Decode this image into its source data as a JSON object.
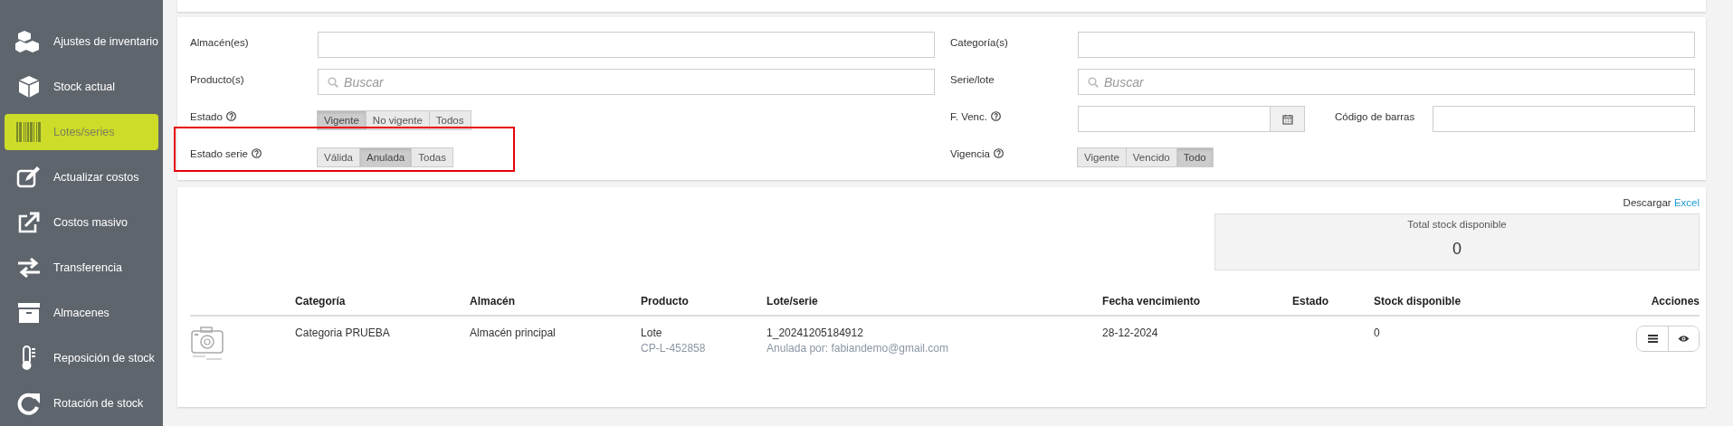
{
  "sidebar": {
    "items": [
      {
        "label": "Ajustes de inventario",
        "selected": false
      },
      {
        "label": "Stock actual",
        "selected": false
      },
      {
        "label": "Lotes/series",
        "selected": true
      },
      {
        "label": "Actualizar costos",
        "selected": false
      },
      {
        "label": "Costos masivo",
        "selected": false
      },
      {
        "label": "Transferencia",
        "selected": false
      },
      {
        "label": "Almacenes",
        "selected": false
      },
      {
        "label": "Reposición de stock",
        "selected": false
      },
      {
        "label": "Rotación de stock",
        "selected": false
      }
    ]
  },
  "filters": {
    "left": [
      {
        "kind": "field",
        "label": "Almacén(es)",
        "help": false,
        "highlighted": false
      },
      {
        "kind": "search",
        "label": "Producto(s)",
        "placeholder": "Buscar",
        "help": false,
        "highlighted": false
      },
      {
        "kind": "toggle",
        "label": "Estado",
        "help": true,
        "highlighted": false,
        "options": [
          {
            "label": "Vigente",
            "selected": true
          },
          {
            "label": "No vigente",
            "selected": false
          },
          {
            "label": "Todos",
            "selected": false
          }
        ]
      },
      {
        "kind": "toggle",
        "label": "Estado serie",
        "help": true,
        "highlighted": true,
        "options": [
          {
            "label": "Válida",
            "selected": false
          },
          {
            "label": "Anulada",
            "selected": true
          },
          {
            "label": "Todas",
            "selected": false
          }
        ]
      }
    ],
    "right": [
      {
        "kind": "field",
        "label": "Categoría(s)",
        "help": false,
        "highlighted": false
      },
      {
        "kind": "search",
        "label": "Serie/lote",
        "placeholder": "Buscar",
        "help": false,
        "highlighted": false
      },
      {
        "kind": "date",
        "label": "F. Venc.",
        "help": true,
        "highlighted": false,
        "side_label": "Código de barras"
      },
      {
        "kind": "toggle",
        "label": "Vigencia",
        "help": true,
        "highlighted": false,
        "options": [
          {
            "label": "Vigente",
            "selected": false
          },
          {
            "label": "Vencido",
            "selected": false
          },
          {
            "label": "Todo",
            "selected": true
          }
        ]
      }
    ]
  },
  "download": {
    "text": "Descargar",
    "link": "Excel"
  },
  "total": {
    "label": "Total stock disponible",
    "value": "0"
  },
  "table": {
    "columns": [
      "Categoría",
      "Almacén",
      "Producto",
      "Lote/serie",
      "Fecha vencimiento",
      "Estado",
      "Stock disponible",
      "Acciones"
    ],
    "rows": [
      {
        "category": "Categoria PRUEBA",
        "warehouse": "Almacén principal",
        "product": "Lote",
        "product_code": "CP-L-452858",
        "lot": "1_20241205184912",
        "lot_note": "Anulada por: fabiandemo@gmail.com",
        "expiry": "28-12-2024",
        "stock": "0"
      }
    ]
  }
}
